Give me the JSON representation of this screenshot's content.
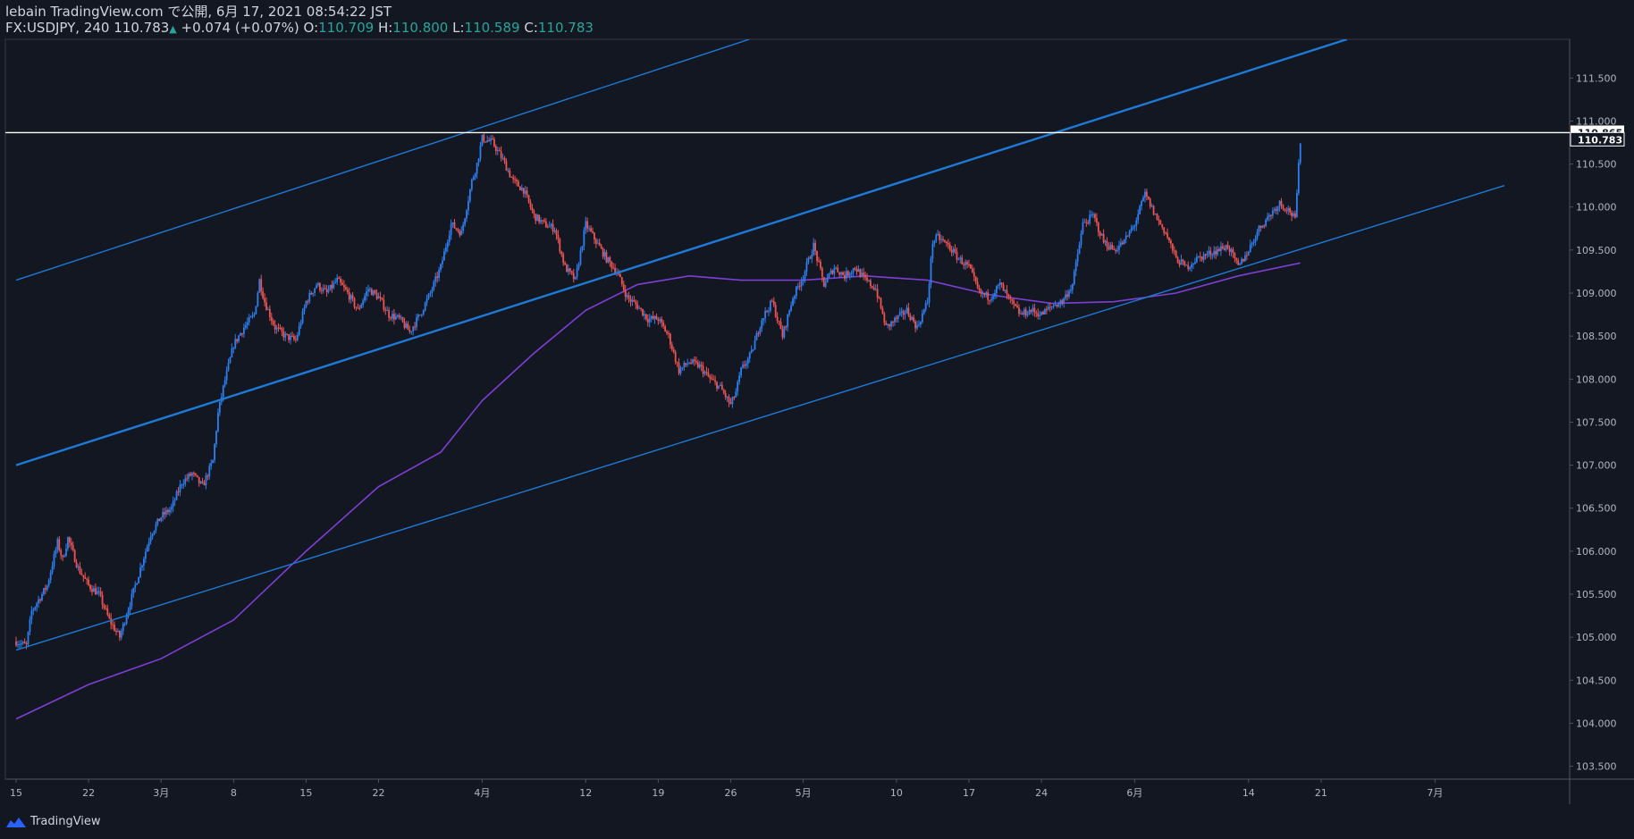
{
  "header": {
    "line1": "lebain TradingView.com で公開, 6月 17, 2021 08:54:22 JST",
    "symbol": "FX:USDJPY, 240",
    "last": "110.783",
    "change": "+0.074 (+0.07%)",
    "o_label": "O:",
    "o_value": "110.709",
    "h_label": "H:",
    "h_value": "110.800",
    "l_label": "L:",
    "l_value": "110.589",
    "c_label": "C:",
    "c_value": "110.783"
  },
  "footer": {
    "brand": "TradingView",
    "logo_icon": "tradingview-logo-icon"
  },
  "colors": {
    "background": "#131722",
    "up": "#2d7ff0",
    "down": "#ef5350",
    "trendline": "#1e7ad6",
    "moving_average": "#7e3fd4",
    "horizontal_line": "#ffffff",
    "axis_text": "#b2b5be",
    "grid": "#363a45"
  },
  "chart_data": {
    "type": "candlestick",
    "timeframe": "240",
    "symbol": "FX:USDJPY",
    "y_axis": {
      "ylim": [
        103.35,
        111.95
      ],
      "ticks": [
        "103.500",
        "104.000",
        "104.500",
        "105.000",
        "105.500",
        "106.000",
        "106.500",
        "107.000",
        "107.500",
        "108.000",
        "108.500",
        "109.000",
        "109.500",
        "110.000",
        "110.500",
        "110.783",
        "110.865",
        "111.000",
        "111.500"
      ],
      "tick_values": [
        103.5,
        104.0,
        104.5,
        105.0,
        105.5,
        106.0,
        106.5,
        107.0,
        107.5,
        108.0,
        108.5,
        109.0,
        109.5,
        110.0,
        110.5,
        111.0,
        111.5
      ]
    },
    "x_axis": {
      "ticks": [
        "15",
        "22",
        "3月",
        "8",
        "15",
        "22",
        "4月",
        "12",
        "19",
        "26",
        "5月",
        "10",
        "17",
        "24",
        "6月",
        "14",
        "21",
        "7月"
      ],
      "tick_days": [
        0,
        7,
        14,
        21,
        28,
        35,
        45,
        55,
        62,
        69,
        76,
        85,
        92,
        99,
        108,
        119,
        126,
        137
      ]
    },
    "price_tags": [
      {
        "value": 110.865,
        "label": "110.865",
        "style": "horizontal-line"
      },
      {
        "value": 110.783,
        "label": "110.783",
        "style": "last-price"
      }
    ],
    "horizontal_line": 110.865,
    "anchors": [
      [
        0,
        104.95
      ],
      [
        1,
        104.9
      ],
      [
        1.5,
        105.3
      ],
      [
        3,
        105.6
      ],
      [
        4,
        106.1
      ],
      [
        4.5,
        105.9
      ],
      [
        5,
        106.15
      ],
      [
        6,
        105.8
      ],
      [
        7,
        105.6
      ],
      [
        8,
        105.5
      ],
      [
        9,
        105.2
      ],
      [
        10,
        105.0
      ],
      [
        11,
        105.4
      ],
      [
        12,
        105.8
      ],
      [
        13,
        106.2
      ],
      [
        14,
        106.4
      ],
      [
        15,
        106.5
      ],
      [
        16,
        106.8
      ],
      [
        17,
        106.9
      ],
      [
        18,
        106.75
      ],
      [
        19,
        107.05
      ],
      [
        19.5,
        107.6
      ],
      [
        20,
        107.9
      ],
      [
        21,
        108.4
      ],
      [
        22,
        108.6
      ],
      [
        23,
        108.75
      ],
      [
        23.5,
        109.15
      ],
      [
        24,
        108.9
      ],
      [
        25,
        108.6
      ],
      [
        26,
        108.5
      ],
      [
        27,
        108.45
      ],
      [
        28,
        108.9
      ],
      [
        29,
        109.1
      ],
      [
        30,
        109.0
      ],
      [
        31,
        109.15
      ],
      [
        32,
        109.0
      ],
      [
        33,
        108.8
      ],
      [
        34,
        109.05
      ],
      [
        35,
        108.95
      ],
      [
        36,
        108.75
      ],
      [
        37,
        108.7
      ],
      [
        38,
        108.55
      ],
      [
        39,
        108.75
      ],
      [
        40,
        109.0
      ],
      [
        41,
        109.3
      ],
      [
        42,
        109.8
      ],
      [
        43,
        109.7
      ],
      [
        44,
        110.3
      ],
      [
        44.5,
        110.5
      ],
      [
        45,
        110.8
      ],
      [
        46,
        110.75
      ],
      [
        47,
        110.55
      ],
      [
        48,
        110.3
      ],
      [
        49,
        110.2
      ],
      [
        50,
        109.9
      ],
      [
        51,
        109.8
      ],
      [
        52,
        109.75
      ],
      [
        53,
        109.3
      ],
      [
        54,
        109.15
      ],
      [
        55,
        109.8
      ],
      [
        56,
        109.6
      ],
      [
        57,
        109.4
      ],
      [
        58,
        109.25
      ],
      [
        59,
        108.95
      ],
      [
        60,
        108.85
      ],
      [
        61,
        108.7
      ],
      [
        62,
        108.7
      ],
      [
        63,
        108.5
      ],
      [
        64,
        108.1
      ],
      [
        65,
        108.2
      ],
      [
        66,
        108.15
      ],
      [
        67,
        108.0
      ],
      [
        68,
        107.9
      ],
      [
        69,
        107.7
      ],
      [
        69.5,
        107.85
      ],
      [
        70,
        108.1
      ],
      [
        71,
        108.3
      ],
      [
        72,
        108.7
      ],
      [
        73,
        108.9
      ],
      [
        74,
        108.5
      ],
      [
        75,
        108.95
      ],
      [
        76,
        109.2
      ],
      [
        77,
        109.55
      ],
      [
        78,
        109.1
      ],
      [
        79,
        109.3
      ],
      [
        80,
        109.2
      ],
      [
        81,
        109.3
      ],
      [
        82,
        109.15
      ],
      [
        83,
        109.05
      ],
      [
        84,
        108.6
      ],
      [
        85,
        108.7
      ],
      [
        86,
        108.8
      ],
      [
        87,
        108.6
      ],
      [
        88,
        108.9
      ],
      [
        88.5,
        109.6
      ],
      [
        89,
        109.65
      ],
      [
        90,
        109.55
      ],
      [
        91,
        109.4
      ],
      [
        92,
        109.3
      ],
      [
        93,
        109.0
      ],
      [
        94,
        108.95
      ],
      [
        95,
        109.1
      ],
      [
        96,
        108.9
      ],
      [
        97,
        108.75
      ],
      [
        98,
        108.8
      ],
      [
        99,
        108.75
      ],
      [
        100,
        108.85
      ],
      [
        101,
        108.9
      ],
      [
        102,
        109.1
      ],
      [
        103,
        109.8
      ],
      [
        104,
        109.9
      ],
      [
        105,
        109.6
      ],
      [
        106,
        109.5
      ],
      [
        107,
        109.6
      ],
      [
        108,
        109.8
      ],
      [
        109,
        110.15
      ],
      [
        110,
        109.9
      ],
      [
        111,
        109.7
      ],
      [
        112,
        109.4
      ],
      [
        113,
        109.3
      ],
      [
        114,
        109.4
      ],
      [
        115,
        109.45
      ],
      [
        116,
        109.5
      ],
      [
        117,
        109.55
      ],
      [
        118,
        109.3
      ],
      [
        119,
        109.5
      ],
      [
        120,
        109.75
      ],
      [
        121,
        109.9
      ],
      [
        122,
        110.05
      ],
      [
        123,
        109.95
      ],
      [
        123.5,
        109.85
      ],
      [
        124,
        110.78
      ]
    ],
    "moving_average": [
      [
        0,
        104.05
      ],
      [
        7,
        104.45
      ],
      [
        14,
        104.75
      ],
      [
        21,
        105.2
      ],
      [
        28,
        106.0
      ],
      [
        35,
        106.75
      ],
      [
        41,
        107.15
      ],
      [
        45,
        107.75
      ],
      [
        50,
        108.3
      ],
      [
        55,
        108.8
      ],
      [
        60,
        109.1
      ],
      [
        65,
        109.2
      ],
      [
        70,
        109.15
      ],
      [
        76,
        109.15
      ],
      [
        82,
        109.2
      ],
      [
        88,
        109.15
      ],
      [
        94,
        108.98
      ],
      [
        100,
        108.88
      ],
      [
        106,
        108.9
      ],
      [
        112,
        109.0
      ],
      [
        118,
        109.2
      ],
      [
        124,
        109.35
      ]
    ],
    "trendlines": [
      {
        "name": "",
        "from": [
          0,
          109.15
        ],
        "to": [
          70.8,
          111.95
        ],
        "width": 1.4
      },
      {
        "name": "",
        "from": [
          0,
          107.0
        ],
        "to": [
          128.5,
          111.95
        ],
        "width": 2.4
      },
      {
        "name": "",
        "from": [
          0,
          104.85
        ],
        "to": [
          143.7,
          110.25
        ],
        "width": 1.4
      }
    ]
  }
}
